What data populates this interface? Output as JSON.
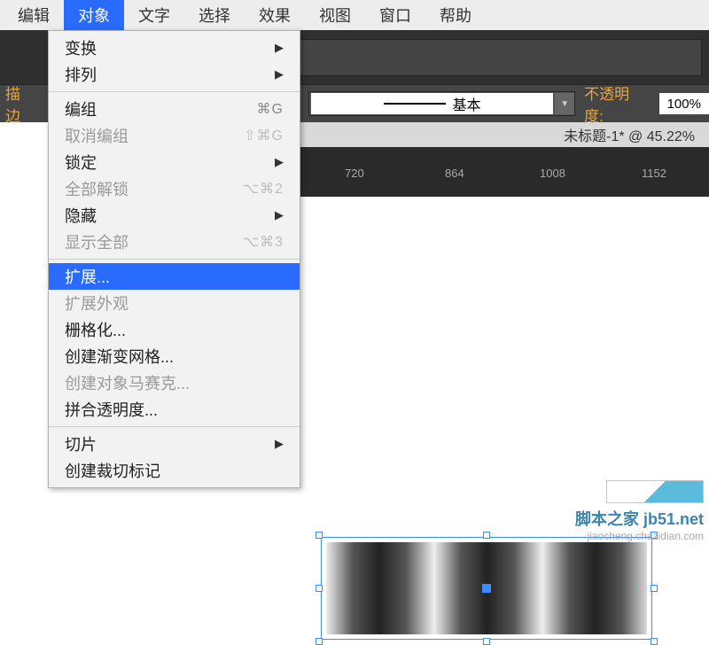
{
  "menubar": {
    "items": [
      {
        "label": "编辑"
      },
      {
        "label": "对象",
        "active": true
      },
      {
        "label": "文字"
      },
      {
        "label": "选择"
      },
      {
        "label": "效果"
      },
      {
        "label": "视图"
      },
      {
        "label": "窗口"
      },
      {
        "label": "帮助"
      }
    ]
  },
  "toolbar": {
    "stroke_label": "描边",
    "stroke_style": "基本",
    "opacity_label": "不透明度:",
    "opacity_value": "100%"
  },
  "doc_tab": {
    "title": "未标题-1* @ 45.22%"
  },
  "ruler": {
    "ticks": [
      "720",
      "864",
      "1008",
      "1152"
    ]
  },
  "dropdown": {
    "items": [
      {
        "label": "变换",
        "submenu": true
      },
      {
        "label": "排列",
        "submenu": true
      },
      {
        "sep": true
      },
      {
        "label": "编组",
        "shortcut": "⌘G"
      },
      {
        "label": "取消编组",
        "shortcut": "⇧⌘G",
        "disabled": true
      },
      {
        "label": "锁定",
        "submenu": true
      },
      {
        "label": "全部解锁",
        "shortcut": "⌥⌘2",
        "disabled": true
      },
      {
        "label": "隐藏",
        "submenu": true
      },
      {
        "label": "显示全部",
        "shortcut": "⌥⌘3",
        "disabled": true
      },
      {
        "sep": true
      },
      {
        "label": "扩展...",
        "highlight": true
      },
      {
        "label": "扩展外观",
        "disabled": true
      },
      {
        "label": "栅格化..."
      },
      {
        "label": "创建渐变网格..."
      },
      {
        "label": "创建对象马赛克...",
        "disabled": true
      },
      {
        "label": "拼合透明度..."
      },
      {
        "sep": true
      },
      {
        "label": "切片",
        "submenu": true
      },
      {
        "label": "创建裁切标记"
      }
    ]
  },
  "watermark": {
    "line1": "脚本之家 jb51.net",
    "line2": "jiaocheng.chazidian.com"
  }
}
